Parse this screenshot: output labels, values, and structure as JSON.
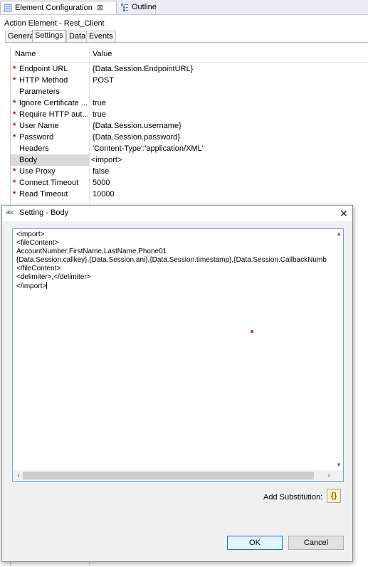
{
  "tabs": [
    {
      "label": "Element Configuration",
      "close": "⊠",
      "icon": "element-config-icon"
    },
    {
      "label": "Outline",
      "icon": "outline-icon"
    }
  ],
  "panel": {
    "title": "Action Element - Rest_Client",
    "subtabs": [
      "General",
      "Settings",
      "Data",
      "Events"
    ],
    "active_subtab": "Settings"
  },
  "table": {
    "headers": [
      "Name",
      "Value"
    ],
    "rows": [
      {
        "required": true,
        "name": "Endpoint URL",
        "value": "{Data.Session.EndpointURL}"
      },
      {
        "required": true,
        "name": "HTTP Method",
        "value": "POST"
      },
      {
        "required": false,
        "name": "Parameters",
        "value": ""
      },
      {
        "required": true,
        "name": "Ignore Certificate ...",
        "value": "true"
      },
      {
        "required": true,
        "name": "Require HTTP aut...",
        "value": "true"
      },
      {
        "required": true,
        "name": "User Name",
        "value": "{Data.Session.username}"
      },
      {
        "required": true,
        "name": "Password",
        "value": "{Data.Session.password}"
      },
      {
        "required": false,
        "name": "Headers",
        "value": "'Content-Type':'application/XML'"
      },
      {
        "required": false,
        "name": "Body",
        "value": "<import>",
        "selected": true
      },
      {
        "required": true,
        "name": "Use Proxy",
        "value": "false"
      },
      {
        "required": true,
        "name": "Connect Timeout",
        "value": "5000"
      },
      {
        "required": true,
        "name": "Read Timeout",
        "value": "10000"
      }
    ]
  },
  "dialog": {
    "icon_text": "abc",
    "title": "Setting - Body",
    "close": "✕",
    "editor_lines": [
      "<import>",
      "<fileContent>",
      "AccountNumber,FirstName,LastName,Phone01",
      "{Data.Session.callkey},{Data.Session.ani},{Data.Session.timestamp},{Data.Session.CallbackNumb",
      "</fileContent>",
      "<delimiter>,</delimiter>",
      "</import>"
    ],
    "add_substitution_label": "Add Substitution:",
    "substitution_button": "{}",
    "ok_label": "OK",
    "cancel_label": "Cancel"
  },
  "colors": {
    "required_star": "#c00000",
    "editor_border": "#7aa1cf",
    "ok_border": "#0078d7",
    "marker_dot": "#d81e1e"
  }
}
